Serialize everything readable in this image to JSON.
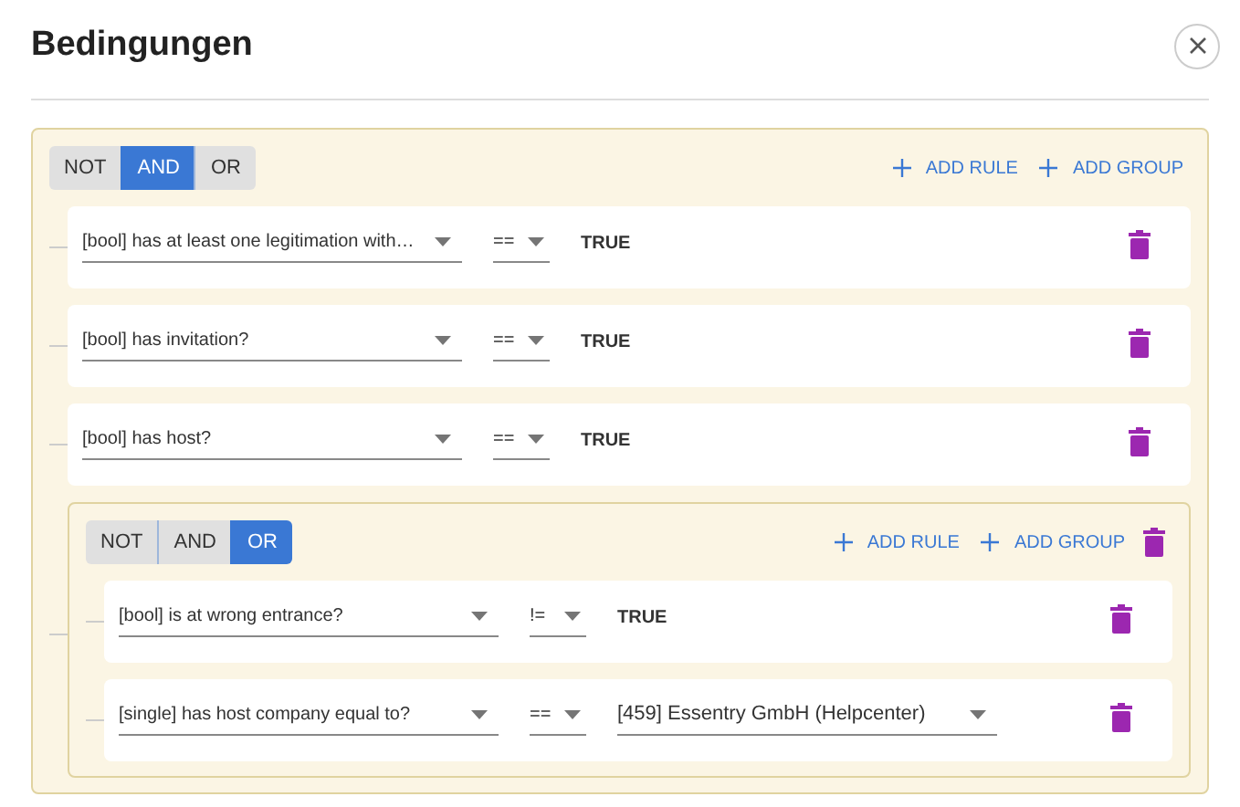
{
  "dialog": {
    "title": "Bedingungen"
  },
  "root_group": {
    "combinators": [
      {
        "label": "NOT",
        "selected": false
      },
      {
        "label": "AND",
        "selected": true
      },
      {
        "label": "OR",
        "selected": false
      }
    ],
    "actions": [
      "ADD RULE",
      "ADD GROUP"
    ],
    "children": [
      {
        "kind": "rule",
        "field": "[bool] has at least one legitimation with…",
        "operator": "==",
        "value": {
          "kind": "text",
          "text": "TRUE"
        }
      },
      {
        "kind": "rule",
        "field": "[bool] has invitation?",
        "operator": "==",
        "value": {
          "kind": "text",
          "text": "TRUE"
        }
      },
      {
        "kind": "rule",
        "field": "[bool] has host?",
        "operator": "==",
        "value": {
          "kind": "text",
          "text": "TRUE"
        }
      },
      {
        "kind": "group",
        "combinators": [
          {
            "label": "NOT",
            "selected": false
          },
          {
            "label": "AND",
            "selected": false
          },
          {
            "label": "OR",
            "selected": true
          }
        ],
        "actions": [
          "ADD RULE",
          "ADD GROUP"
        ],
        "children": [
          {
            "kind": "rule",
            "field": "[bool] is at wrong entrance?",
            "operator": "!=",
            "value": {
              "kind": "text",
              "text": "TRUE"
            }
          },
          {
            "kind": "rule",
            "field": "[single] has host company equal to?",
            "operator": "==",
            "value": {
              "kind": "select",
              "text": "[459] Essentry GmbH (Helpcenter)"
            }
          }
        ]
      }
    ]
  }
}
